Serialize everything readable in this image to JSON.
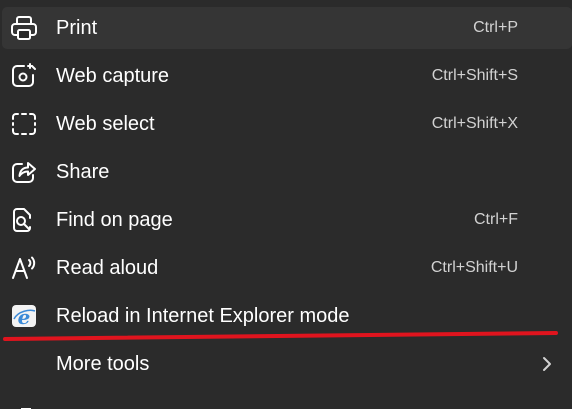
{
  "menu": {
    "items": [
      {
        "label": "Print",
        "shortcut": "Ctrl+P",
        "icon": "printer-icon"
      },
      {
        "label": "Web capture",
        "shortcut": "Ctrl+Shift+S",
        "icon": "web-capture-icon"
      },
      {
        "label": "Web select",
        "shortcut": "Ctrl+Shift+X",
        "icon": "web-select-icon"
      },
      {
        "label": "Share",
        "shortcut": "",
        "icon": "share-icon"
      },
      {
        "label": "Find on page",
        "shortcut": "Ctrl+F",
        "icon": "find-on-page-icon"
      },
      {
        "label": "Read aloud",
        "shortcut": "Ctrl+Shift+U",
        "icon": "read-aloud-icon"
      },
      {
        "label": "Reload in Internet Explorer mode",
        "shortcut": "",
        "icon": "internet-explorer-icon"
      },
      {
        "label": "More tools",
        "shortcut": "",
        "icon": "chevron-right-icon"
      }
    ]
  },
  "colors": {
    "background": "#2b2b2b",
    "hover": "#353535",
    "text": "#ffffff",
    "shortcut_text": "#d2d2d2",
    "annotation_red": "#e0141e",
    "ie_blue": "#3b8ad8"
  }
}
